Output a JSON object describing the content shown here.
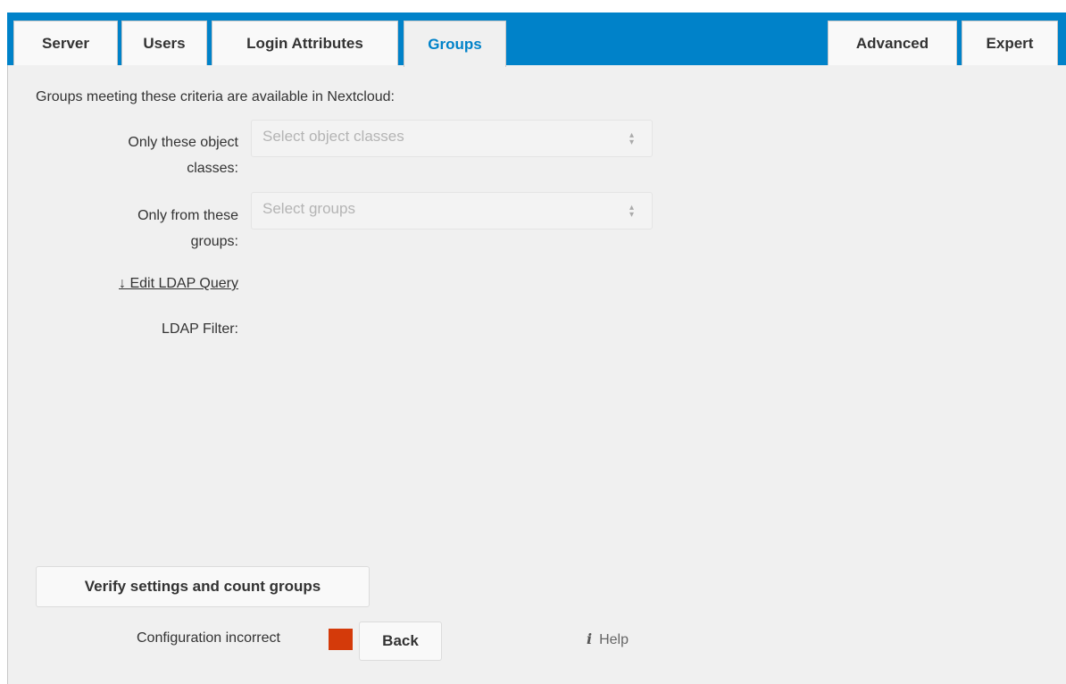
{
  "tabs": [
    {
      "label": "Server"
    },
    {
      "label": "Users"
    },
    {
      "label": "Login Attributes"
    },
    {
      "label": "Groups",
      "active": true
    },
    {
      "label": "Advanced"
    },
    {
      "label": "Expert"
    }
  ],
  "intro": "Groups meeting these criteria are available in Nextcloud:",
  "object_classes": {
    "label_line1": "Only these object",
    "label_line2": "classes:",
    "placeholder": "Select object classes"
  },
  "groups_filter": {
    "label_line1": "Only from these",
    "label_line2": "groups:",
    "placeholder": "Select groups"
  },
  "edit_query_link": "↓ Edit LDAP Query",
  "ldap_filter_label": "LDAP Filter:",
  "verify_button": "Verify settings and count groups",
  "status": {
    "text": "Configuration incorrect",
    "color": "#d43a0a"
  },
  "back_button": "Back",
  "help": {
    "icon": "i",
    "label": "Help"
  },
  "colors": {
    "accent": "#0082c9",
    "panel": "#f0f0f0"
  }
}
